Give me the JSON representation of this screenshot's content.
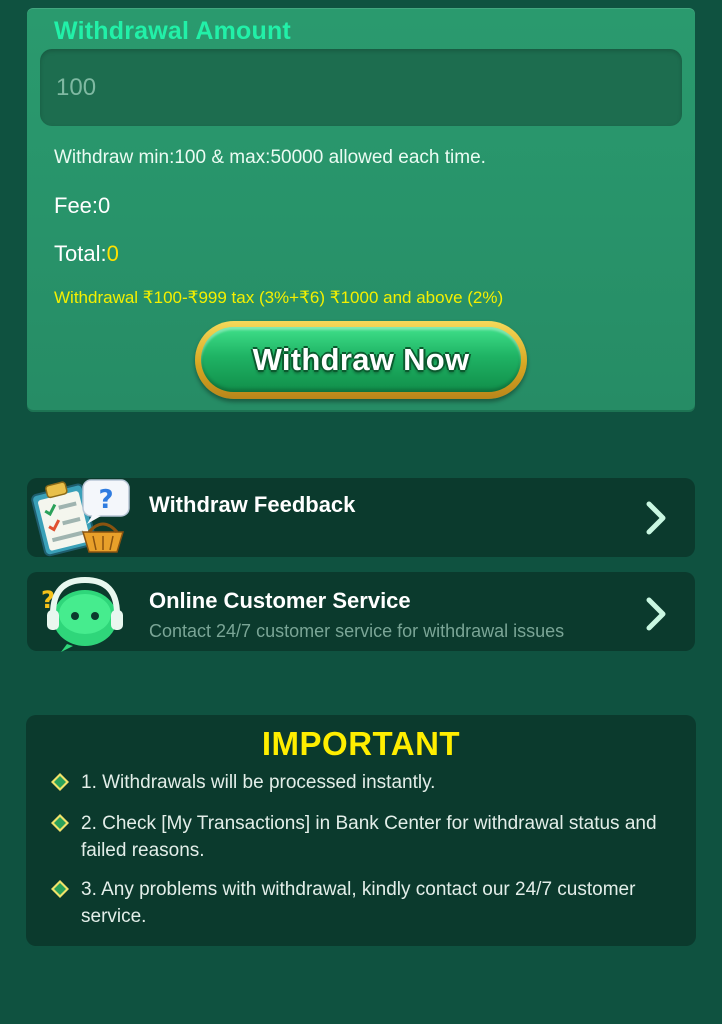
{
  "withdrawal": {
    "title": "Withdrawal Amount",
    "amount_placeholder": "100",
    "limit_text": "Withdraw min:100 & max:50000 allowed each time.",
    "fee_label": "Fee:",
    "fee_value": "0",
    "total_label": "Total:",
    "total_value": "0",
    "tax_text": "Withdrawal ₹100-₹999 tax (3%+₹6) ₹1000 and above (2%)",
    "button_label": "Withdraw Now"
  },
  "links": {
    "feedback": {
      "title": "Withdraw Feedback",
      "icon": "feedback-clipboard-icon"
    },
    "customer_service": {
      "title": "Online Customer Service",
      "subtitle": "Contact 24/7 customer service for withdrawal issues",
      "icon": "support-headset-icon"
    }
  },
  "important": {
    "title": "IMPORTANT",
    "items": [
      "1. Withdrawals will be processed instantly.",
      "2. Check [My Transactions] in Bank Center for withdrawal status and failed reasons.",
      "3. Any problems with withdrawal, kindly contact our 24/7 customer service."
    ]
  },
  "colors": {
    "background": "#0f5240",
    "panel": "#28936a",
    "accent_title": "#22f0a8",
    "highlight_yellow": "#ffe100",
    "card": "#0b3a2d"
  }
}
